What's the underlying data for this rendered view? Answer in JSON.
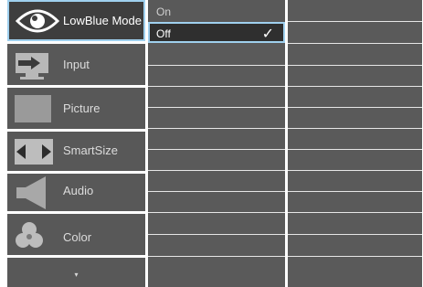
{
  "menu": {
    "items": [
      {
        "label": "LowBlue Mode",
        "icon": "eye-icon",
        "active": true
      },
      {
        "label": "Input",
        "icon": "input-source-icon",
        "active": false
      },
      {
        "label": "Picture",
        "icon": "picture-icon",
        "active": false
      },
      {
        "label": "SmartSize",
        "icon": "smartsize-icon",
        "active": false
      },
      {
        "label": "Audio",
        "icon": "speaker-icon",
        "active": false
      },
      {
        "label": "Color",
        "icon": "color-circles-icon",
        "active": false
      }
    ],
    "scroll_indicator": "▾"
  },
  "submenu": {
    "options": [
      {
        "label": "On",
        "selected": false
      },
      {
        "label": "Off",
        "selected": true
      }
    ],
    "check_glyph": "✓"
  },
  "colors": {
    "highlight_border": "#9fd0ee",
    "panel_bg": "#585858",
    "active_bg": "#3e3e3e"
  }
}
